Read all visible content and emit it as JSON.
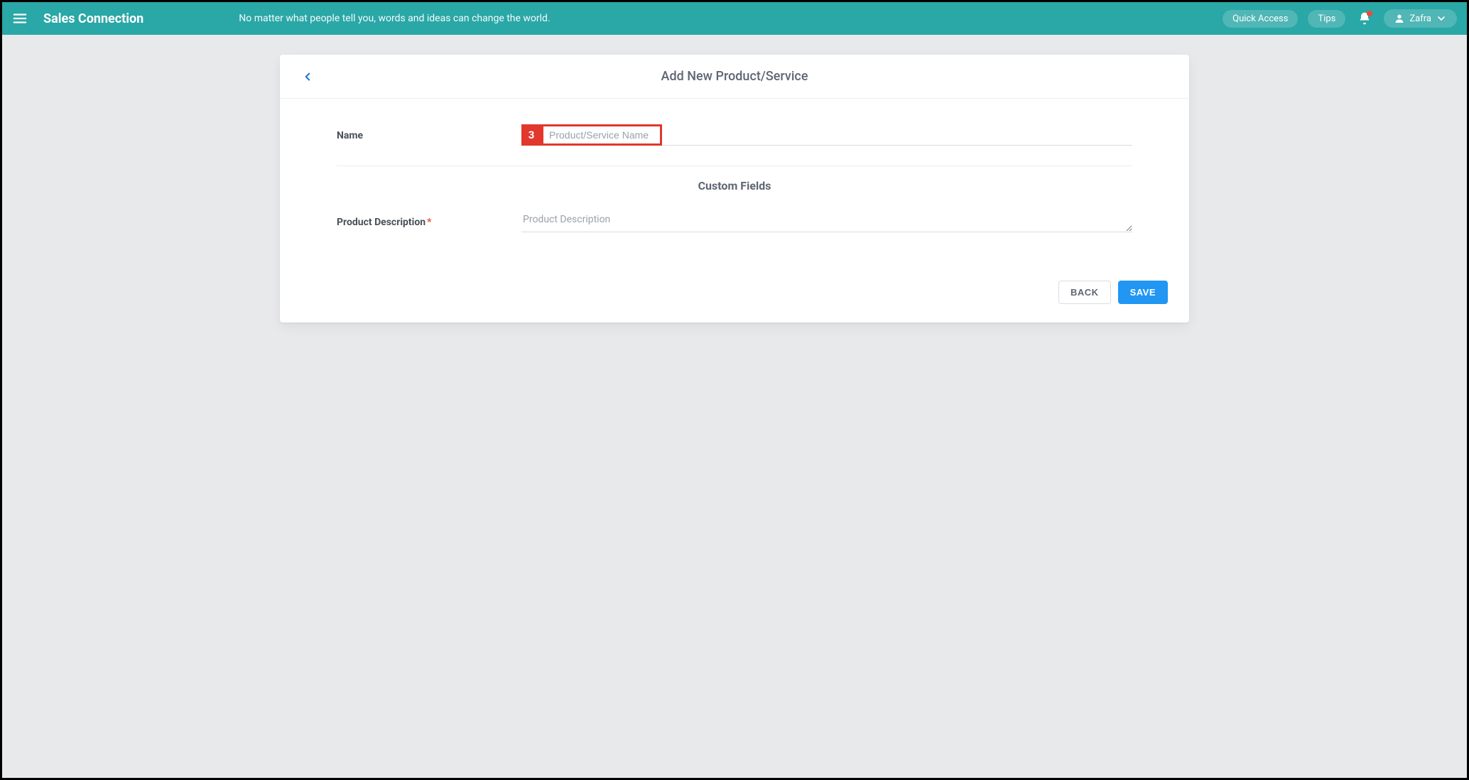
{
  "header": {
    "brand": "Sales Connection",
    "tagline": "No matter what people tell you, words and ideas can change the world.",
    "quick_access_label": "Quick Access",
    "tips_label": "Tips",
    "user_name": "Zafra"
  },
  "card": {
    "title": "Add New Product/Service",
    "name_label": "Name",
    "name_placeholder": "Product/Service Name",
    "custom_fields_heading": "Custom Fields",
    "desc_label": "Product Description",
    "desc_placeholder": "Product Description",
    "back_label": "BACK",
    "save_label": "SAVE"
  },
  "callout": {
    "number": "3"
  }
}
